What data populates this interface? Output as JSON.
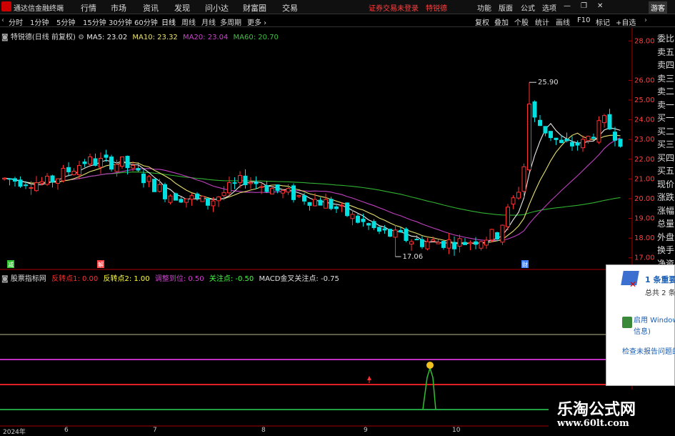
{
  "menubar": {
    "app_title": "通达信金融终端",
    "items": [
      "行情",
      "市场",
      "资讯",
      "发现",
      "问小达",
      "财富圈",
      "交易"
    ],
    "warning": "证券交易未登录",
    "warning_name": "特锐德",
    "right_items": [
      "功能",
      "版面",
      "公式",
      "选项"
    ],
    "guest": "游客"
  },
  "periodbar": {
    "periods": [
      "分时",
      "1分钟",
      "5分钟",
      "15分钟",
      "30分钟",
      "60分钟",
      "日线",
      "周线",
      "月线",
      "多周期",
      "更多 ›"
    ],
    "active": "日线",
    "tools": [
      "复权",
      "叠加",
      "个股",
      "统计",
      "画线",
      "F10",
      "标记",
      "+自选"
    ]
  },
  "ma_line": {
    "stock": "特锐德(日线 前复权)",
    "items": [
      {
        "label": "MA5: 23.02",
        "color": "#e8e8e8"
      },
      {
        "label": "MA10: 23.32",
        "color": "#e8e070"
      },
      {
        "label": "MA20: 23.04",
        "color": "#d040d0"
      },
      {
        "label": "MA60: 20.70",
        "color": "#40c040"
      }
    ]
  },
  "indicator_line": {
    "name": "股票指标网",
    "items": [
      {
        "label": "反转点1: 0.00",
        "color": "#ff3030"
      },
      {
        "label": "反转点2: 1.00",
        "color": "#ffff40"
      },
      {
        "label": "调整到位: 0.50",
        "color": "#d040d0"
      },
      {
        "label": "关注点: -0.50",
        "color": "#40ff40"
      },
      {
        "label": "MACD金叉关注点: -0.75",
        "color": "#e0e0e0"
      }
    ]
  },
  "chart_data": {
    "type": "candlestick",
    "y_ticks": [
      "28.00",
      "26.00",
      "25.00",
      "24.00",
      "23.00",
      "22.00",
      "21.00",
      "20.00",
      "19.00",
      "18.00",
      "17.00"
    ],
    "ylim": [
      16.7,
      28.3
    ],
    "annotations": {
      "high": "25.90",
      "low": "17.06"
    },
    "markers": [
      "减",
      "解",
      "财"
    ],
    "x_ticks": [
      "2024年",
      "6",
      "7",
      "8",
      "9",
      "10"
    ]
  },
  "right_panel": {
    "labels": [
      "委比",
      "卖五",
      "卖四",
      "卖三",
      "卖二",
      "卖一",
      "买一",
      "买二",
      "买三",
      "买四",
      "买五",
      "现价",
      "涨跌",
      "涨幅",
      "总量",
      "外盘",
      "换手",
      "净资"
    ]
  },
  "notification": {
    "title": "1 条重要消",
    "subtitle": "总共 2 条",
    "item1": "启用 Window",
    "item1b": "信息)",
    "link": "检查未报告问题的"
  },
  "watermark": {
    "title": "乐淘公式网",
    "url": "www.60lt.com"
  },
  "colors": {
    "up": "#ff3030",
    "down": "#00e0e0",
    "ma5": "#e8e8e8",
    "ma10": "#e8e070",
    "ma20": "#c040c0",
    "ma60": "#30b030"
  }
}
